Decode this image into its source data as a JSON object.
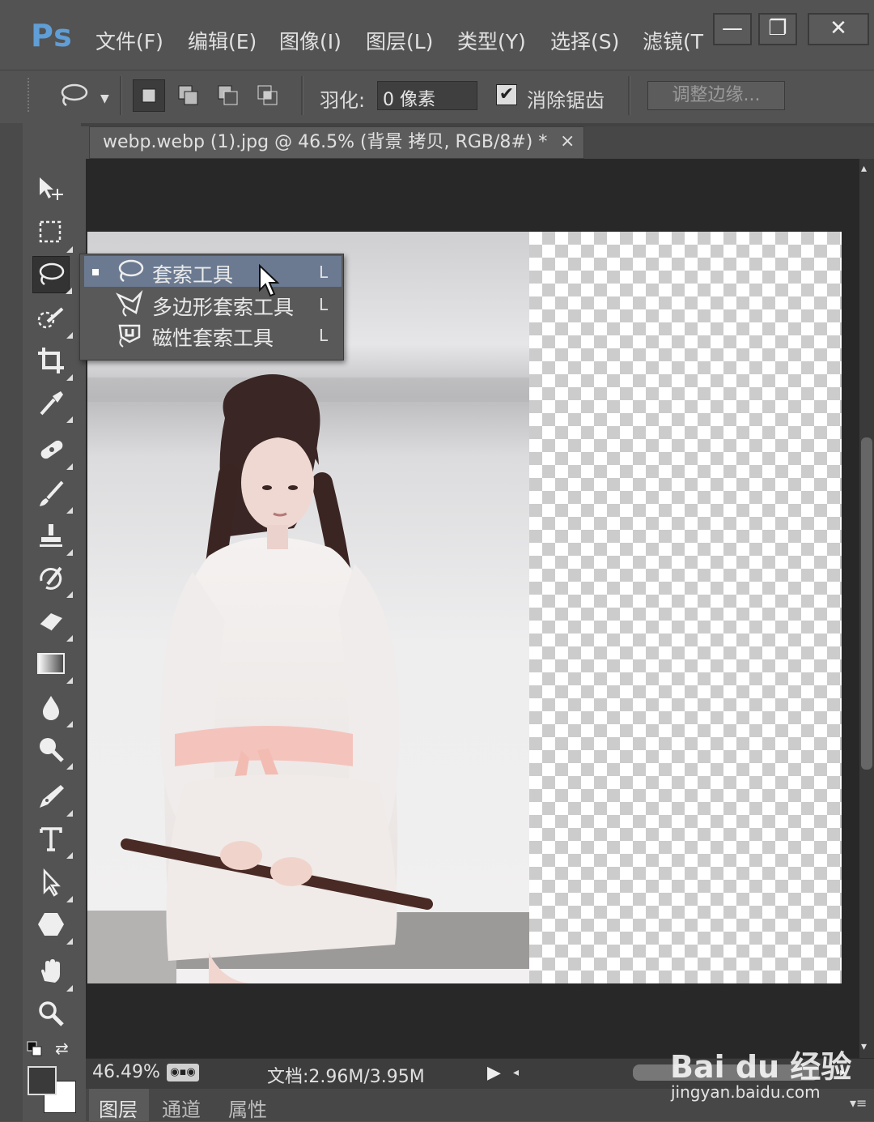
{
  "app": {
    "logo": "Ps"
  },
  "menu": [
    "文件(F)",
    "编辑(E)",
    "图像(I)",
    "图层(L)",
    "类型(Y)",
    "选择(S)",
    "滤镜(T"
  ],
  "window_controls": {
    "minimize": "—",
    "restore": "❐",
    "close": "✕"
  },
  "options_bar": {
    "feather_label": "羽化:",
    "feather_value": "0 像素",
    "antialias_label": "消除锯齿",
    "antialias_checked": "✔",
    "refine_edge_label": "调整边缘..."
  },
  "document": {
    "tab_title": "webp.webp (1).jpg @ 46.5% (背景 拷贝, RGB/8#) *",
    "tab_close": "×"
  },
  "flyout": [
    {
      "label": "套索工具",
      "key": "L",
      "icon": "lasso-icon",
      "selected": true
    },
    {
      "label": "多边形套索工具",
      "key": "L",
      "icon": "polygonal-lasso-icon",
      "selected": false
    },
    {
      "label": "磁性套索工具",
      "key": "L",
      "icon": "magnetic-lasso-icon",
      "selected": false
    }
  ],
  "status": {
    "zoom": "46.49%",
    "doc_size": "文档:2.96M/3.95M"
  },
  "panel_tabs": [
    "图层",
    "通道",
    "属性"
  ],
  "tool_icons": [
    "move-icon",
    "marquee-icon",
    "lasso-icon",
    "quick-select-icon",
    "crop-icon",
    "eyedropper-icon",
    "healing-brush-icon",
    "brush-icon",
    "stamp-icon",
    "history-brush-icon",
    "eraser-icon",
    "gradient-icon",
    "blur-icon",
    "dodge-icon",
    "pen-icon",
    "type-icon",
    "path-select-icon",
    "shape-icon",
    "hand-icon",
    "zoom-icon"
  ],
  "watermark": {
    "text": "Bai du 经验",
    "url": "jingyan.baidu.com"
  }
}
